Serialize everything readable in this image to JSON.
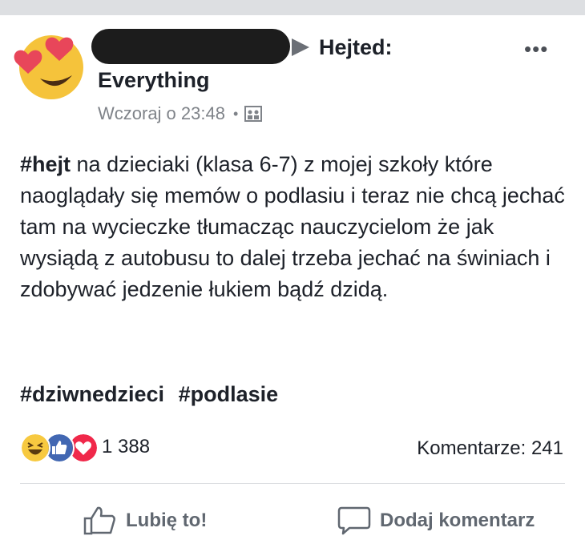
{
  "header": {
    "group_title_line1": "Hejted:",
    "group_title_line2": "Everything",
    "more_label": "•••",
    "timestamp": "Wczoraj o 23:48",
    "separator": "•",
    "privacy_icon": "group-privacy-icon"
  },
  "post": {
    "hashtag_hejt": "#hejt",
    "text": " na dzieciaki (klasa 6-7) z mojej szkoły które naoglądały się memów o podlasiu i teraz nie chcą jechać tam na wycieczke tłumacząc nauczycielom że jak wysiądą z autobusu to dalej trzeba jechać na świniach i zdobywać jedzenie łukiem bądź dzidą.",
    "hashtags": [
      "#dziwnedzieci",
      "#podlasie"
    ]
  },
  "reactions": {
    "icons": [
      "haha-icon",
      "like-icon",
      "love-icon"
    ],
    "count": "1 388",
    "comments": "Komentarze: 241"
  },
  "actions": {
    "like_label": "Lubię to!",
    "comment_label": "Dodaj komentarz"
  },
  "colors": {
    "like_blue": "#4267b2",
    "love_red": "#f0284a",
    "haha_yellow": "#f7c940",
    "muted_text": "#7f8389"
  }
}
